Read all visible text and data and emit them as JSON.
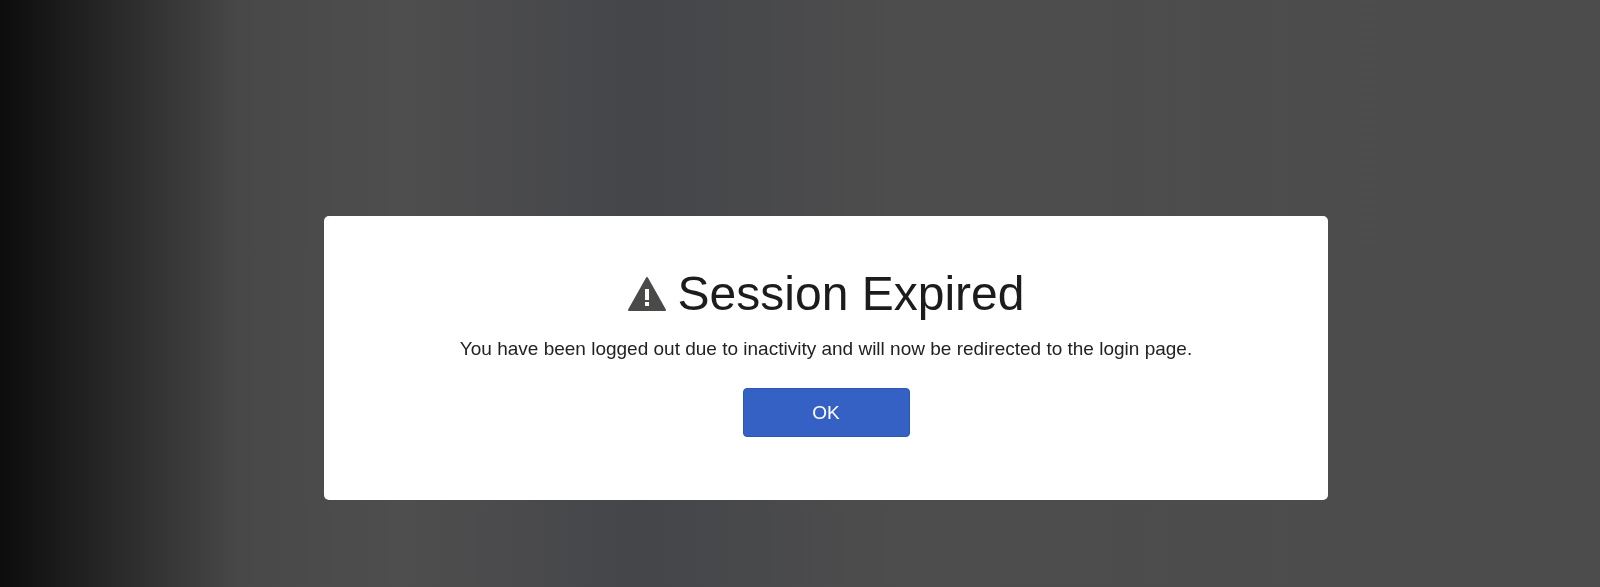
{
  "dialog": {
    "title": "Session Expired",
    "message": "You have been logged out due to inactivity and will now be redirected to the login page.",
    "buttons": [
      {
        "label": "OK",
        "kind": "primary"
      }
    ]
  }
}
